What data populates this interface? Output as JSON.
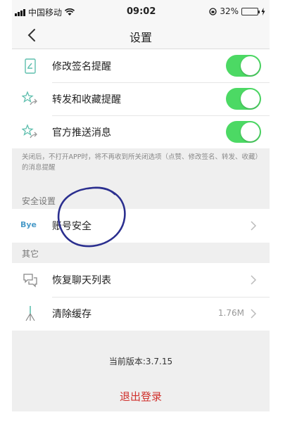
{
  "status_bar": {
    "carrier": "中国移动",
    "time": "09:02",
    "battery_percent": "32%",
    "battery_level": 0.32
  },
  "nav": {
    "title": "设置"
  },
  "notification_items": [
    {
      "label": "修改签名提醒",
      "enabled": true
    },
    {
      "label": "转发和收藏提醒",
      "enabled": true
    },
    {
      "label": "官方推送消息",
      "enabled": true
    }
  ],
  "notification_note": "关闭后，不打开APP时，将不再收到所关闭选项（点赞、修改签名、转发、收藏）的消息提醒",
  "security": {
    "section_label": "安全设置",
    "account_icon_text": "Bye",
    "account_label": "账号安全"
  },
  "other": {
    "section_label": "其它",
    "restore_label": "恢复聊天列表",
    "cache_label": "清除缓存",
    "cache_size": "1.76M"
  },
  "footer": {
    "version": "当前版本:3.7.15",
    "logout": "退出登录"
  },
  "colors": {
    "toggle_on": "#4cd964",
    "logout": "#d0312d",
    "annotation_circle": "#2b2f8f"
  },
  "icons": [
    "signal-icon",
    "wifi-icon",
    "back-icon",
    "edit-signature-icon",
    "star-share-icon",
    "chevron-right-icon",
    "chat-bubble-icon",
    "broom-icon"
  ]
}
